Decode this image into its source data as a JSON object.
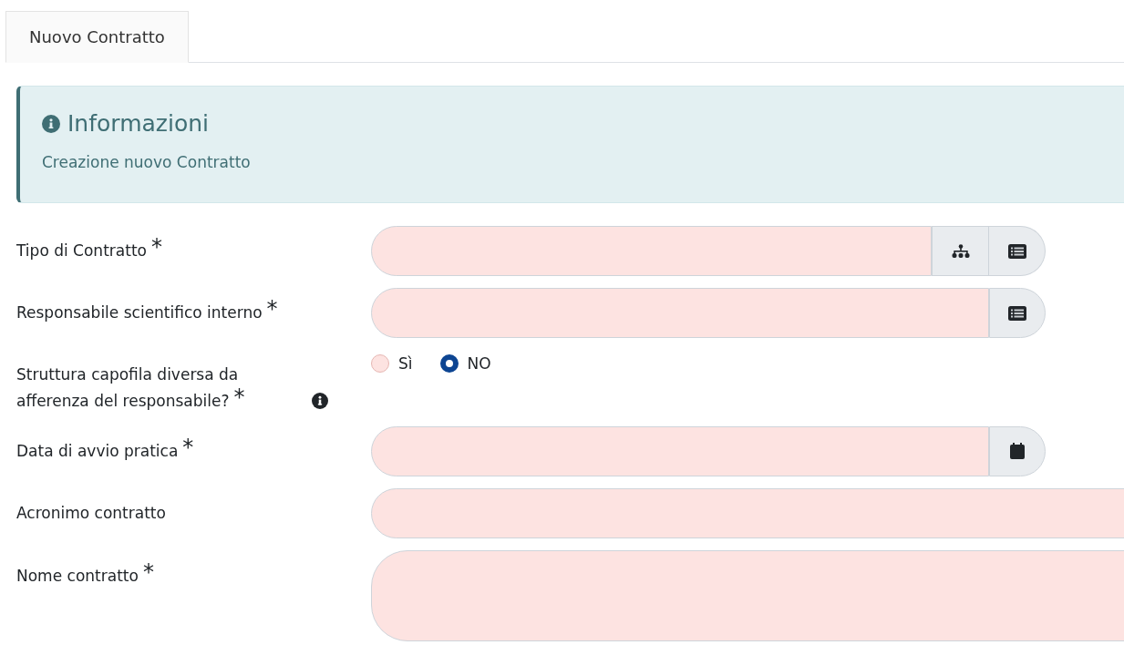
{
  "tabs": [
    {
      "label": "Nuovo Contratto",
      "selected": true
    }
  ],
  "info_box": {
    "title": "Informazioni",
    "text": "Creazione nuovo Contratto"
  },
  "fields": [
    {
      "kind": "input",
      "label": "Tipo di Contratto",
      "required_mark": "*",
      "invalid": true,
      "addons": [
        {
          "kind": "tree"
        },
        {
          "kind": "list"
        }
      ],
      "wide": false
    },
    {
      "kind": "input",
      "label": "Responsabile scientifico interno",
      "required_mark": "*",
      "invalid": true,
      "addons": [
        {
          "kind": "list"
        }
      ],
      "wide": false
    },
    {
      "kind": "radio",
      "label": "Struttura capofila diversa da afferenza del responsabile?",
      "required_mark": "*",
      "info": true,
      "invalid": true,
      "options": [
        {
          "label": "Sì",
          "selected": false
        },
        {
          "label": "NO",
          "selected": true
        }
      ]
    },
    {
      "kind": "input",
      "label": "Data di avvio pratica",
      "required_mark": "*",
      "invalid": true,
      "addons": [
        {
          "kind": "calendar"
        }
      ],
      "wide": false
    },
    {
      "kind": "input",
      "label": "Acronimo contratto",
      "invalid": true,
      "wide": true
    },
    {
      "kind": "textarea",
      "label": "Nome contratto",
      "required_mark": "*",
      "invalid": true,
      "wide": true
    }
  ]
}
